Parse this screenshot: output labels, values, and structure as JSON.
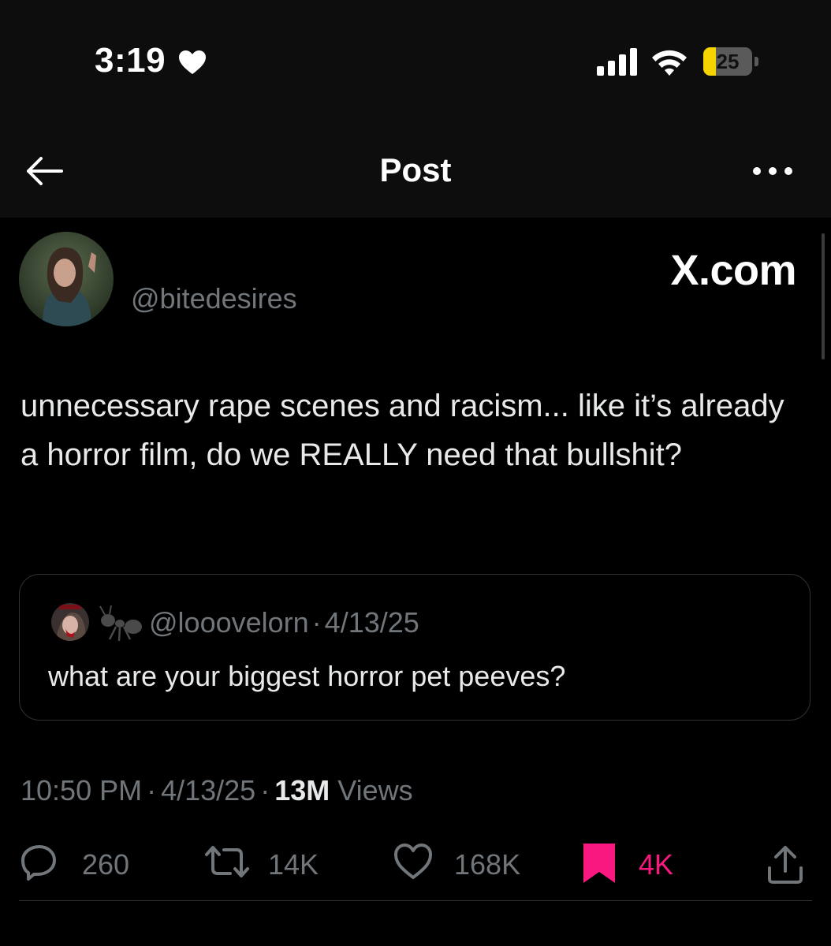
{
  "status_bar": {
    "time": "3:19",
    "battery": "25",
    "battery_level": 0.25
  },
  "header": {
    "title": "Post"
  },
  "post": {
    "handle": "@bitedesires",
    "watermark": "X.com",
    "text": "unnecessary rape scenes and racism... like it’s already a horror film, do we REALLY need that bullshit?",
    "quote": {
      "handle": "@looovelorn",
      "separator": "·",
      "date": "4/13/25",
      "text": "what are your biggest horror pet peeves?"
    },
    "meta": {
      "time": "10:50 PM",
      "separator": "·",
      "date": "4/13/25",
      "views_count": "13M",
      "views_label": "Views"
    },
    "actions": {
      "replies": "260",
      "reposts": "14K",
      "likes": "168K",
      "bookmarks": "4K"
    }
  },
  "colors": {
    "background": "#000000",
    "secondary_text": "#71767b",
    "primary_text": "#e7e9ea",
    "bookmark_active": "#f91880",
    "battery_fill": "#f5d400"
  }
}
